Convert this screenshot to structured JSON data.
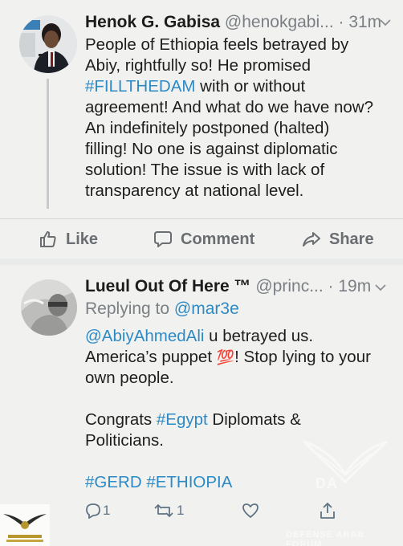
{
  "tweet1": {
    "name": "Henok G. Gabisa",
    "handle": "@henokgabi...",
    "time": "· 31m",
    "lines": [
      "People of Ethiopia feels betrayed by",
      "Abiy, rightfully so! He promised",
      "#FILLTHEDAM",
      " with or without",
      "agreement! And what do we have now?",
      "An indefinitely postponed  (halted)",
      "filling! No one is against diplomatic",
      "solution! The issue is with lack of",
      "transparency at national level."
    ],
    "actions": {
      "like": "Like",
      "comment": "Comment",
      "share": "Share"
    }
  },
  "tweet2": {
    "name": "Lueul Out Of Here ™",
    "handle": "@princ...",
    "time": "· 19m",
    "replying_prefix": "Replying to ",
    "replying_to": "@mar3e",
    "mention": "@AbiyAhmedAli",
    "line1_rest": " u betrayed us.",
    "line2_pre": "America’s puppet ",
    "emoji": "💯",
    "line2_post": "! Stop lying to your",
    "line3": "own people.",
    "line4_pre": "Congrats ",
    "hashtag_egypt": "#Egypt",
    "line4_post": " Diplomats &",
    "line5": "Politicians.",
    "hashtags": "#GERD #ETHIOPIA",
    "reply_count": "1",
    "retweet_count": "1"
  },
  "watermark": {
    "logo_text": "DA",
    "text": "DEFENSE ARAB FORUM"
  },
  "colors": {
    "link": "#2d8ac5",
    "background": "#f1f1ef",
    "separator": "#e9eaea",
    "muted": "#7a7f84"
  }
}
